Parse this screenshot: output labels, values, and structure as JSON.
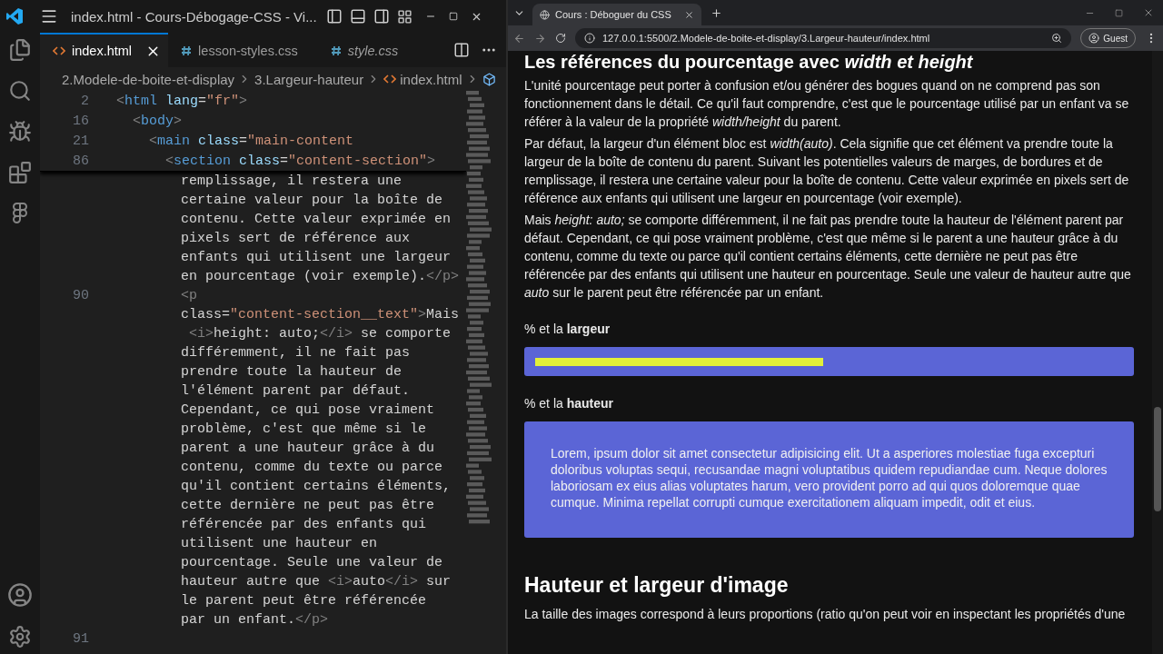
{
  "editor": {
    "title": "index.html - Cours-Débogage-CSS - Vi...",
    "tabs": [
      {
        "label": "index.html",
        "kind": "html",
        "selected": true,
        "italic": false
      },
      {
        "label": "lesson-styles.css",
        "kind": "css",
        "selected": false,
        "italic": false
      },
      {
        "label": "style.css",
        "kind": "css",
        "selected": false,
        "italic": true
      }
    ],
    "breadcrumbs": [
      {
        "label": "2.Modele-de-boite-et-display",
        "kind": "folder"
      },
      {
        "label": "3.Largeur-hauteur",
        "kind": "folder"
      },
      {
        "label": "index.html",
        "kind": "html"
      },
      {
        "kind": "symbol"
      }
    ],
    "sticky": {
      "number": "2",
      "tokens": [
        {
          "kind": "punct",
          "t": "<"
        },
        {
          "kind": "tag",
          "t": "html"
        },
        {
          "kind": "attr",
          "t": " lang"
        },
        {
          "kind": "text",
          "t": "="
        },
        {
          "kind": "string",
          "t": "\"fr\""
        },
        {
          "kind": "punct",
          "t": ">"
        }
      ],
      "children": [
        {
          "number": "16",
          "tokens": [
            {
              "kind": "punct",
              "t": "<"
            },
            {
              "kind": "tag",
              "t": "body"
            },
            {
              "kind": "punct",
              "t": ">"
            }
          ],
          "children": [
            {
              "number": "21",
              "tokens": [
                {
                  "kind": "punct",
                  "t": "<"
                },
                {
                  "kind": "tag",
                  "t": "main"
                },
                {
                  "kind": "attr",
                  "t": " class"
                },
                {
                  "kind": "text",
                  "t": "="
                },
                {
                  "kind": "string",
                  "t": "\"main-content"
                }
              ],
              "children": [
                {
                  "number": "86",
                  "tokens": [
                    {
                      "kind": "punct",
                      "t": "<"
                    },
                    {
                      "kind": "tag",
                      "t": "section"
                    },
                    {
                      "kind": "attr",
                      "t": " class"
                    },
                    {
                      "kind": "text",
                      "t": "="
                    },
                    {
                      "kind": "string",
                      "t": "\"content-section\""
                    },
                    {
                      "kind": "punct",
                      "t": ">"
                    }
                  ]
                }
              ]
            }
          ]
        }
      ]
    },
    "lines": [
      {
        "tokens": [
          {
            "kind": "text",
            "t": "remplissage, il restera une"
          }
        ]
      },
      {
        "tokens": [
          {
            "kind": "text",
            "t": "certaine valeur pour la boîte de"
          }
        ]
      },
      {
        "tokens": [
          {
            "kind": "text",
            "t": "contenu. Cette valeur exprimée en"
          }
        ]
      },
      {
        "tokens": [
          {
            "kind": "text",
            "t": "pixels sert de référence aux"
          }
        ]
      },
      {
        "tokens": [
          {
            "kind": "text",
            "t": "enfants qui utilisent une largeur"
          }
        ]
      },
      {
        "tokens": [
          {
            "kind": "text",
            "t": "en pourcentage (voir exemple)."
          },
          {
            "kind": "punct",
            "t": "</p>"
          }
        ]
      },
      {
        "number": "90",
        "tokens": [
          {
            "kind": "punct",
            "t": "<p"
          }
        ]
      },
      {
        "tokens": [
          {
            "kind": "text",
            "t": "class="
          },
          {
            "kind": "string",
            "t": "\"content-section__text\""
          },
          {
            "kind": "punct",
            "t": ">"
          },
          {
            "kind": "text",
            "t": "Mais"
          }
        ]
      },
      {
        "tokens": [
          {
            "kind": "punct",
            "t": " <i>"
          },
          {
            "kind": "text",
            "t": "height: auto;"
          },
          {
            "kind": "punct",
            "t": "</i>"
          },
          {
            "kind": "text",
            "t": " se comporte"
          }
        ]
      },
      {
        "tokens": [
          {
            "kind": "text",
            "t": "différemment, il ne fait pas"
          }
        ]
      },
      {
        "tokens": [
          {
            "kind": "text",
            "t": "prendre toute la hauteur de"
          }
        ]
      },
      {
        "tokens": [
          {
            "kind": "text",
            "t": "l'élément parent par défaut."
          }
        ]
      },
      {
        "tokens": [
          {
            "kind": "text",
            "t": "Cependant, ce qui pose vraiment"
          }
        ]
      },
      {
        "tokens": [
          {
            "kind": "text",
            "t": "problème, c'est que même si le"
          }
        ]
      },
      {
        "tokens": [
          {
            "kind": "text",
            "t": "parent a une hauteur grâce à du"
          }
        ]
      },
      {
        "tokens": [
          {
            "kind": "text",
            "t": "contenu, comme du texte ou parce"
          }
        ]
      },
      {
        "tokens": [
          {
            "kind": "text",
            "t": "qu'il contient certains éléments,"
          }
        ]
      },
      {
        "tokens": [
          {
            "kind": "text",
            "t": "cette dernière ne peut pas être"
          }
        ]
      },
      {
        "tokens": [
          {
            "kind": "text",
            "t": "référencée par des enfants qui"
          }
        ]
      },
      {
        "tokens": [
          {
            "kind": "text",
            "t": "utilisent une hauteur en"
          }
        ]
      },
      {
        "tokens": [
          {
            "kind": "text",
            "t": "pourcentage. Seule une valeur de"
          }
        ]
      },
      {
        "tokens": [
          {
            "kind": "text",
            "t": "hauteur autre que "
          },
          {
            "kind": "punct",
            "t": "<i>"
          },
          {
            "kind": "text",
            "t": "auto"
          },
          {
            "kind": "punct",
            "t": "</i>"
          },
          {
            "kind": "text",
            "t": " sur"
          }
        ]
      },
      {
        "tokens": [
          {
            "kind": "text",
            "t": "le parent peut être référencée"
          }
        ]
      },
      {
        "tokens": [
          {
            "kind": "text",
            "t": "par un enfant."
          },
          {
            "kind": "punct",
            "t": "</p>"
          }
        ]
      },
      {
        "number": "91"
      }
    ]
  },
  "browser": {
    "tab_title": "Cours : Déboguer du CSS",
    "address": "127.0.0.1:5500/2.Modele-de-boite-et-display/3.Largeur-hauteur/index.html",
    "profile": "Guest",
    "heading": "Les références du pourcentage avec *width et height*",
    "paragraphs": [
      "L'unité pourcentage peut porter à confusion et/ou générer des bogues quand on ne comprend pas son fonctionnement dans le détail. Ce qu'il faut comprendre, c'est que le pourcentage utilisé par un enfant va se référer à la valeur de la propriété *width/height* du parent.",
      "Par défaut, la largeur d'un élément bloc est *width(auto)*. Cela signifie que cet élément va prendre toute la largeur de la boîte de contenu du parent. Suivant les potentielles valeurs de marges, de bordures et de remplissage, il restera une certaine valeur pour la boîte de contenu. Cette valeur exprimée en pixels sert de référence aux enfants qui utilisent une largeur en pourcentage (voir exemple).",
      "Mais *height: auto;* se comporte différemment, il ne fait pas prendre toute la hauteur de l'élément parent par défaut. Cependant, ce qui pose vraiment problème, c'est que même si le parent a une hauteur grâce à du contenu, comme du texte ou parce qu'il contient certains éléments, cette dernière ne peut pas être référencée par des enfants qui utilisent une hauteur en pourcentage. Seule une valeur de hauteur autre que *auto* sur le parent peut être référencée par un enfant."
    ],
    "demos": [
      {
        "kind": "bar",
        "label": "% et la **largeur**"
      },
      {
        "kind": "box",
        "label": "% et la **hauteur**",
        "text": "Lorem, ipsum dolor sit amet consectetur adipisicing elit. Ut a asperiores molestiae fuga excepturi doloribus voluptas sequi, recusandae magni voluptatibus quidem repudiandae cum. Neque dolores laboriosam ex eius alias voluptates harum, vero provident porro ad qui quos doloremque quae cumque. Minima repellat corrupti cumque exercitationem aliquam impedit, odit et eius."
      }
    ],
    "subheading": "Hauteur et largeur d'image",
    "last_paragraph": "La taille des images correspond à leurs proportions (ratio qu'on peut voir en inspectant les propriétés d'une"
  }
}
